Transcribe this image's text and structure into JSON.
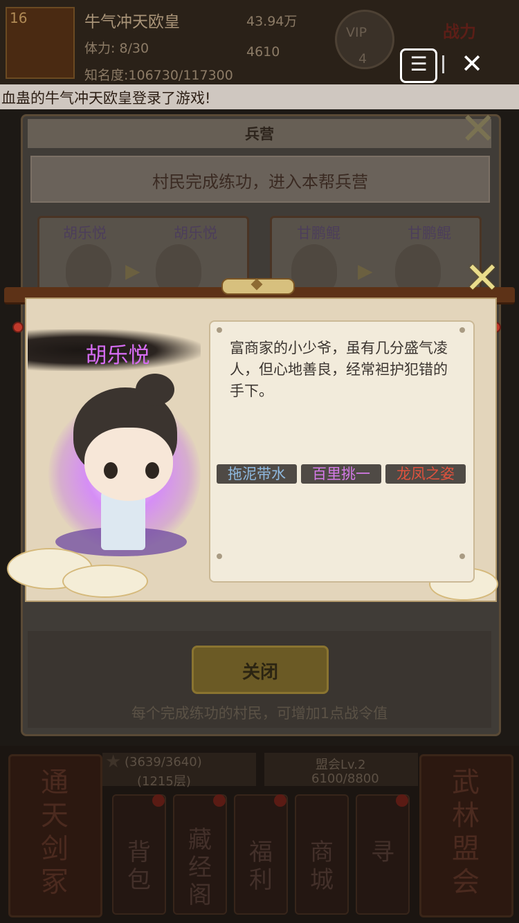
{
  "hud": {
    "level": "16",
    "player_name": "牛气冲天欧皇",
    "silver": "43.94万",
    "stamina": "体力: 8/30",
    "gold": "4610",
    "fame": "知名度:106730/117300",
    "vip": "VIP",
    "vip_level": "4",
    "power": "战力"
  },
  "broadcast": "血蛊的牛气冲天欧皇登录了游戏!",
  "top_controls": {
    "menu_icon": "menu-icon",
    "close_icon": "close-icon",
    "menu_label": "☰",
    "close_label": "✕"
  },
  "barracks": {
    "title": "兵营",
    "banner": "村民完成练功，进入本帮兵营",
    "cards": [
      {
        "left_name": "胡乐悦",
        "right_name": "胡乐悦"
      },
      {
        "left_name": "甘鹏鲲",
        "right_name": "甘鹏鲲"
      }
    ],
    "close_button": "关闭",
    "footer": "每个完成练功的村民，可增加1点战令值"
  },
  "detail": {
    "name": "胡乐悦",
    "name_color": "#d56cf2",
    "description": "富商家的小少爷，虽有几分盛气凌人，但心地善良，经常袒护犯错的手下。",
    "traits": [
      {
        "label": "拖泥带水",
        "color": "#8fb9df",
        "bg": "#4f4a45"
      },
      {
        "label": "百里挑一",
        "color": "#d57ae8",
        "bg": "#4f4a45"
      },
      {
        "label": "龙凤之姿",
        "color": "#e0523e",
        "bg": "#4f4a45"
      }
    ]
  },
  "bottom": {
    "left_tile": "通天剑冢",
    "right_tile": "武林盟会",
    "stars": "(3639/3640)",
    "floor": "(1215层)",
    "alliance": "盟会Lv.2",
    "alliance_progress": "6100/8800",
    "buttons": [
      "背包",
      "藏经阁",
      "福利",
      "商城",
      "寻"
    ]
  }
}
